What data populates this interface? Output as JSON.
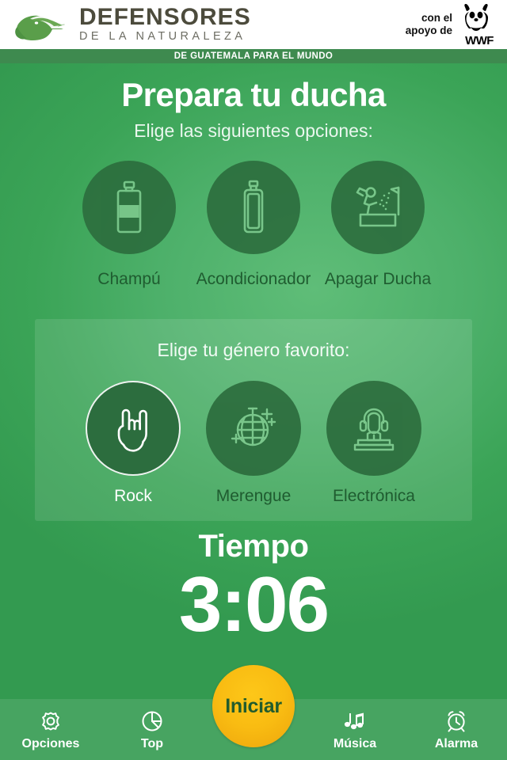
{
  "header": {
    "logo_icon": "anteater-logo-icon",
    "brand_line1": "DEFENSORES",
    "brand_line2": "DE LA NATURALEZA",
    "support_line1": "con el",
    "support_line2": "apoyo de",
    "partner_icon": "wwf-panda-icon",
    "partner_name": "WWF",
    "tagline": "DE GUATEMALA PARA EL MUNDO"
  },
  "main": {
    "title": "Prepara tu ducha",
    "subtitle": "Elige las siguientes opciones:",
    "shower_options": [
      {
        "label": "Champú",
        "icon": "shampoo-bottle-icon",
        "selected": false
      },
      {
        "label": "Acondicionador",
        "icon": "conditioner-bottle-icon",
        "selected": false
      },
      {
        "label": "Apagar Ducha",
        "icon": "shower-off-icon",
        "selected": false
      }
    ]
  },
  "genre": {
    "heading": "Elige tu género favorito:",
    "options": [
      {
        "label": "Rock",
        "icon": "rock-hand-horns-icon",
        "selected": true
      },
      {
        "label": "Merengue",
        "icon": "disco-ball-icon",
        "selected": false
      },
      {
        "label": "Electrónica",
        "icon": "dj-headphones-icon",
        "selected": false
      }
    ]
  },
  "timer": {
    "title": "Tiempo",
    "value": "3:06"
  },
  "nav": {
    "items": [
      {
        "label": "Opciones",
        "icon": "gear-icon"
      },
      {
        "label": "Top",
        "icon": "pie-chart-icon"
      },
      {
        "label": "Música",
        "icon": "music-notes-icon"
      },
      {
        "label": "Alarma",
        "icon": "alarm-clock-icon"
      }
    ],
    "start_label": "Iniciar"
  },
  "colors": {
    "background_green": "#3ea357",
    "circle_green": "#2b6b3c",
    "accent_yellow": "#f9bc12",
    "start_text": "#225c2d",
    "tagline_bar": "#3e8a4f"
  }
}
